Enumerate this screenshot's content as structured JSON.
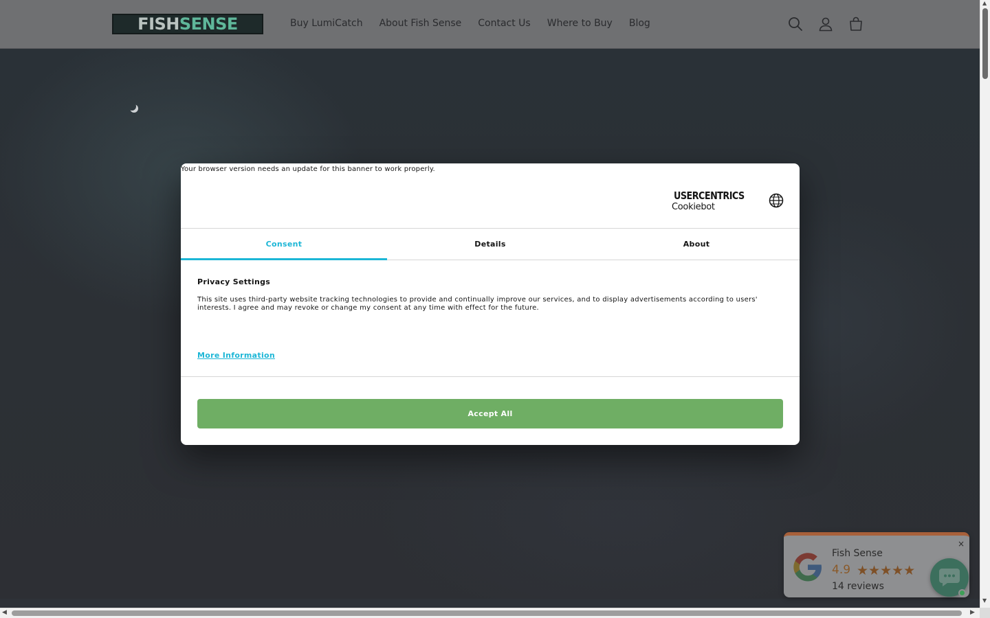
{
  "header": {
    "logo_part1": "FISH",
    "logo_part2": "SENSE",
    "nav": [
      "Buy LumiCatch",
      "About Fish Sense",
      "Contact Us",
      "Where to Buy",
      "Blog"
    ],
    "icons": [
      "search-icon",
      "account-icon",
      "cart-icon"
    ]
  },
  "consent": {
    "update_notice": "Your browser version needs an update for this banner to work properly.",
    "brand_name": "USERCENTRICS",
    "brand_sub": "Cookiebot",
    "tabs": [
      "Consent",
      "Details",
      "About"
    ],
    "active_tab": "Consent",
    "heading": "Privacy Settings",
    "body": "This site uses third-party website tracking technologies to provide and continually improve our services, and to display advertisements according to users' interests. I agree and may revoke or change my consent at any time with effect for the future.",
    "more_info": "More Information",
    "accept_label": "Accept All",
    "accent_color": "#1cb6d6",
    "accept_color": "#6fae64"
  },
  "review": {
    "business": "Fish Sense",
    "rating": "4.9",
    "stars": "★★★★★",
    "count": "14 reviews",
    "close": "×"
  },
  "scrollbars": {
    "arrow_up": "▲",
    "arrow_down": "▼",
    "arrow_left": "◀",
    "arrow_right": "▶"
  }
}
